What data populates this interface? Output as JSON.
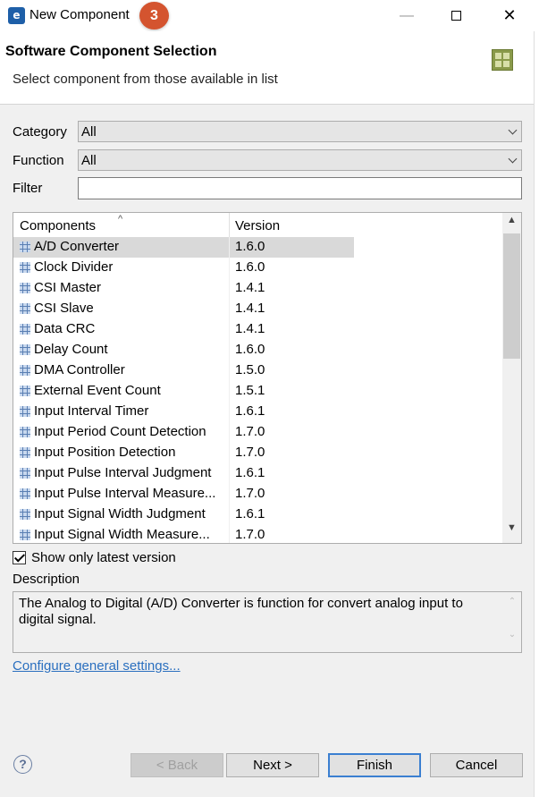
{
  "window": {
    "title": "New Component",
    "badge": "3"
  },
  "header": {
    "title": "Software Component Selection",
    "subtitle": "Select component from those available in list"
  },
  "filters": {
    "category_label": "Category",
    "category_value": "All",
    "function_label": "Function",
    "function_value": "All",
    "filter_label": "Filter",
    "filter_value": ""
  },
  "table": {
    "col_components": "Components",
    "col_version": "Version",
    "rows": [
      {
        "name": "A/D Converter",
        "version": "1.6.0"
      },
      {
        "name": "Clock Divider",
        "version": "1.6.0"
      },
      {
        "name": "CSI Master",
        "version": "1.4.1"
      },
      {
        "name": "CSI Slave",
        "version": "1.4.1"
      },
      {
        "name": "Data CRC",
        "version": "1.4.1"
      },
      {
        "name": "Delay Count",
        "version": "1.6.0"
      },
      {
        "name": "DMA Controller",
        "version": "1.5.0"
      },
      {
        "name": "External Event Count",
        "version": "1.5.1"
      },
      {
        "name": "Input Interval Timer",
        "version": "1.6.1"
      },
      {
        "name": "Input Period Count Detection",
        "version": "1.7.0"
      },
      {
        "name": "Input Position Detection",
        "version": "1.7.0"
      },
      {
        "name": "Input Pulse Interval Judgment",
        "version": "1.6.1"
      },
      {
        "name": "Input Pulse Interval Measure...",
        "version": "1.7.0"
      },
      {
        "name": "Input Signal Width Judgment",
        "version": "1.6.1"
      },
      {
        "name": "Input Signal Width Measure...",
        "version": "1.7.0"
      }
    ]
  },
  "options": {
    "show_latest_label": "Show only latest version"
  },
  "description": {
    "label": "Description",
    "text": "The Analog to Digital (A/D) Converter is function for convert analog input to digital signal."
  },
  "link": {
    "configure": "Configure general settings..."
  },
  "buttons": {
    "back": "< Back",
    "next": "Next >",
    "finish": "Finish",
    "cancel": "Cancel"
  }
}
